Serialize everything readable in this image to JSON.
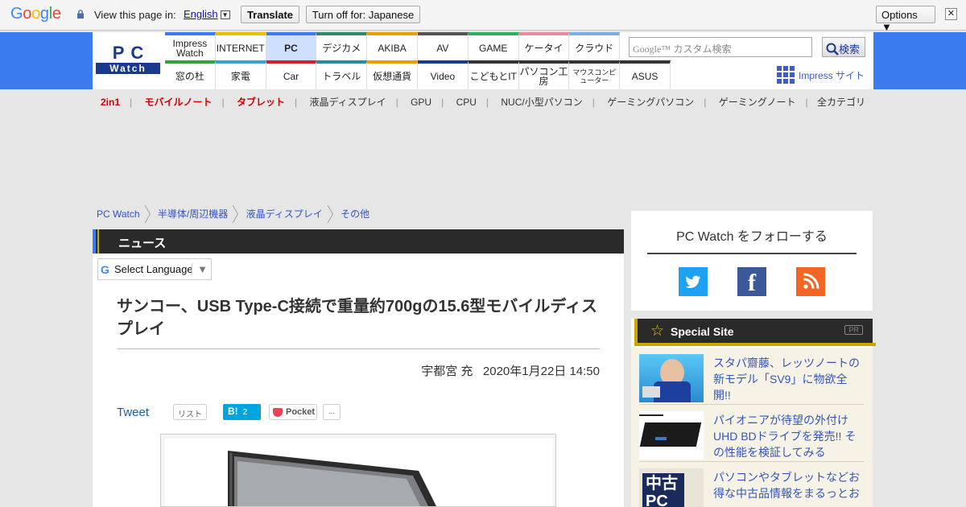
{
  "translate_bar": {
    "logo": "Google",
    "view_label": "View this page in:",
    "language": "English",
    "translate_button": "Translate",
    "turnoff_button": "Turn off for: Japanese",
    "options_button": "Options ▼",
    "close": "✕"
  },
  "header": {
    "logo_top": "PC",
    "logo_bottom": "Watch",
    "nav_row1": [
      "Impress Watch",
      "INTERNET",
      "PC",
      "デジカメ",
      "AKIBA",
      "AV",
      "GAME",
      "ケータイ",
      "クラウド"
    ],
    "nav_row2": [
      "窓の杜",
      "家電",
      "Car",
      "トラベル",
      "仮想通貨",
      "Video",
      "こどもとIT",
      "パソコン工房",
      "マウスコンピューター",
      "ASUS"
    ],
    "search_brand": "Google™",
    "search_placeholder": "カスタム検索",
    "search_button": "検索",
    "impress_site": "Impress サイト",
    "colors": {
      "header_blue": "#3b7bf0",
      "accent_gold": "#c9a600"
    }
  },
  "categories": {
    "items": [
      "2in1",
      "モバイルノート",
      "タブレット",
      "液晶ディスプレイ",
      "GPU",
      "CPU",
      "NUC/小型パソコン",
      "ゲーミングパソコン",
      "ゲーミングノート"
    ],
    "all": "全カテゴリ"
  },
  "breadcrumb": [
    "PC Watch",
    "半導体/周辺機器",
    "液晶ディスプレイ",
    "その他"
  ],
  "article": {
    "section": "ニュース",
    "select_language": "Select Language",
    "title": "サンコー、USB Type-C接続で重量約700gの15.6型モバイルディスプレイ",
    "author": "宇都宮 充",
    "date": "2020年1月22日 14:50",
    "tweet": "Tweet",
    "list": "リスト",
    "hatena": "B!",
    "hatena_count": "2",
    "pocket": "Pocket",
    "more": "..."
  },
  "sidebar": {
    "follow_title": "PC Watch をフォローする",
    "special_title": "Special Site",
    "pr": "PR",
    "items": [
      "スタパ齋藤、レッツノートの新モデル「SV9」に物欲全開!!",
      "パイオニアが待望の外付けUHD BDドライブを発売!! その性能を検証してみる",
      "パソコンやタブレットなどお得な中古品情報をまるっとお"
    ]
  }
}
